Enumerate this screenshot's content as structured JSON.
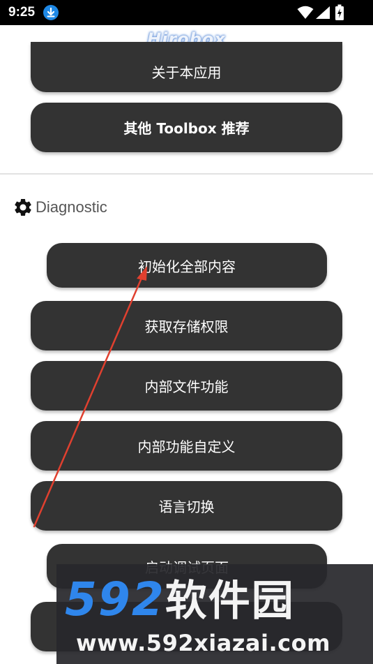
{
  "status_bar": {
    "time": "9:25",
    "download_icon": "download-icon",
    "wifi_icon": "wifi-icon",
    "signal_icon": "signal-icon",
    "battery_icon": "battery-charging-icon"
  },
  "header": {
    "logo_text": "Hirobox"
  },
  "top_buttons": {
    "about": "关于本应用",
    "toolbox": "其他 Toolbox 推荐"
  },
  "diagnostic": {
    "icon": "gear-icon",
    "title": "Diagnostic",
    "buttons": {
      "init_all": "初始化全部内容",
      "storage_permission": "获取存储权限",
      "internal_files": "内部文件功能",
      "custom_functions": "内部功能自定义",
      "language_switch": "语言切换",
      "debug_page": "启动调试页面"
    }
  },
  "watermark": {
    "logo_number": "592",
    "logo_cn": "软件园",
    "url": "www.592xiazai.com"
  },
  "colors": {
    "button_bg": "#333333",
    "annotation_arrow": "#e0402f",
    "watermark_blue": "#2f86ec"
  }
}
